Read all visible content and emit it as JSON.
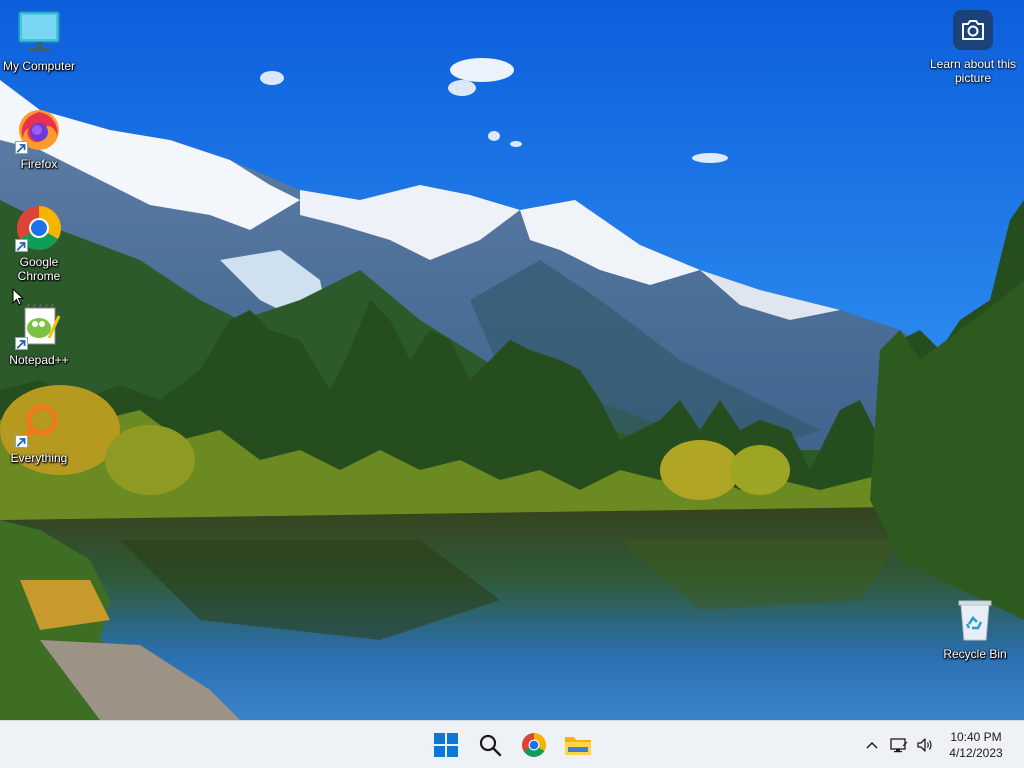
{
  "desktop": {
    "icons": [
      {
        "label": "My Computer"
      },
      {
        "label": "Firefox"
      },
      {
        "label": "Google\nChrome"
      },
      {
        "label": "Notepad++"
      },
      {
        "label": "Everything"
      },
      {
        "label": "Recycle Bin"
      }
    ],
    "spotlight": {
      "label": "Learn about this picture"
    }
  },
  "taskbar": {
    "pinned": [
      "windows-start",
      "search",
      "google-chrome",
      "file-explorer"
    ],
    "tray": {
      "time": "10:40 PM",
      "date": "4/12/2023"
    }
  },
  "colors": {
    "sky": "#1773e6",
    "taskbar": "#eef1f6",
    "windows_blue": "#0a78d4"
  }
}
